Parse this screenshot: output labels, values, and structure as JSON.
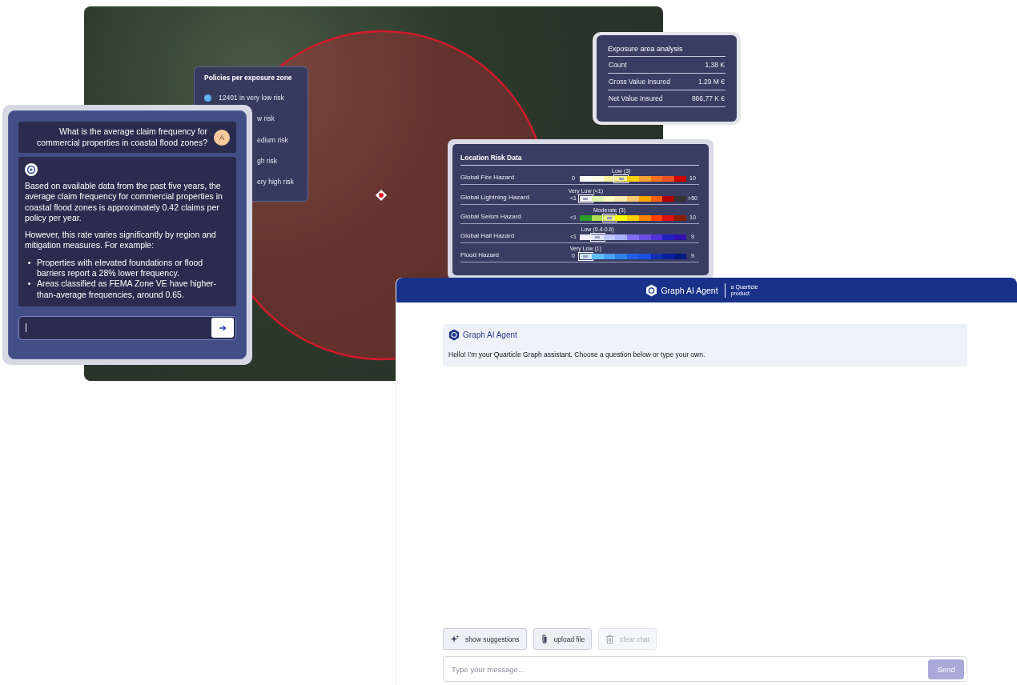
{
  "map": {
    "policies_panel": {
      "title": "Policies per exposure zone",
      "items": [
        {
          "label": "12401 in very low risk",
          "color": "#5fb4f5"
        },
        {
          "label": "w risk"
        },
        {
          "label": "edium risk"
        },
        {
          "label": "gh risk"
        },
        {
          "label": "ery high risk"
        }
      ]
    },
    "exposure_panel": {
      "title": "Exposure area analysis",
      "rows": [
        {
          "label": "Count",
          "value": "1,38 K"
        },
        {
          "label": "Gross Value Insured",
          "value": "1.29 M €"
        },
        {
          "label": "Net Value Insured",
          "value": "866,77 K €"
        }
      ]
    },
    "risk_panel": {
      "title": "Location Risk Data",
      "rows": [
        {
          "name": "Global Fire Hazard",
          "caption": "Low (3)",
          "min": "0",
          "max": "10",
          "segments": [
            {
              "color": "#ffffff",
              "selected": false
            },
            {
              "color": "#fffbe6",
              "selected": false
            },
            {
              "color": "#fff3a0",
              "selected": false
            },
            {
              "color": "#fff08a",
              "selected": true
            },
            {
              "color": "#ffd000",
              "selected": false
            },
            {
              "color": "#f5a030",
              "selected": false
            },
            {
              "color": "#f77020",
              "selected": false
            },
            {
              "color": "#ee5020",
              "selected": false
            },
            {
              "color": "#cc0000",
              "selected": false
            }
          ]
        },
        {
          "name": "Global Lightning Hazard",
          "caption": "Very Low (<1)",
          "min": "<1",
          "max": ">50",
          "segments": [
            {
              "color": "#ffffff",
              "selected": true
            },
            {
              "color": "#e0f5b0",
              "selected": false
            },
            {
              "color": "#ffffc0",
              "selected": false
            },
            {
              "color": "#ffe8b0",
              "selected": false
            },
            {
              "color": "#fdc870",
              "selected": false
            },
            {
              "color": "#ffa500",
              "selected": false
            },
            {
              "color": "#ff6010",
              "selected": false
            },
            {
              "color": "#b00000",
              "selected": false
            },
            {
              "color": "#333333",
              "selected": false
            }
          ]
        },
        {
          "name": "Global Seism Hazard",
          "caption": "Moderate (3)",
          "min": "<1",
          "max": "10",
          "segments": [
            {
              "color": "#2a9d2a",
              "selected": false
            },
            {
              "color": "#b0dd50",
              "selected": false
            },
            {
              "color": "#e8f080",
              "selected": true
            },
            {
              "color": "#ffff00",
              "selected": false
            },
            {
              "color": "#ffd000",
              "selected": false
            },
            {
              "color": "#ff8000",
              "selected": false
            },
            {
              "color": "#ff4000",
              "selected": false
            },
            {
              "color": "#dd1010",
              "selected": false
            },
            {
              "color": "#882000",
              "selected": false
            }
          ]
        },
        {
          "name": "Global Hail Hazard",
          "caption": "Low (0.4-0.6)",
          "min": "<1",
          "max": "9",
          "segments": [
            {
              "color": "#f0f0ff",
              "selected": false
            },
            {
              "color": "#dde4ff",
              "selected": true
            },
            {
              "color": "#c0c8ff",
              "selected": false
            },
            {
              "color": "#a8b0ff",
              "selected": false
            },
            {
              "color": "#8070f0",
              "selected": false
            },
            {
              "color": "#6a50e0",
              "selected": false
            },
            {
              "color": "#5030d8",
              "selected": false
            },
            {
              "color": "#2020c0",
              "selected": false
            },
            {
              "color": "#3010b0",
              "selected": false
            }
          ]
        },
        {
          "name": "Flood Hazard",
          "caption": "Very Low (1)",
          "min": "0",
          "max": "9",
          "segments": [
            {
              "color": "#d0e8ff",
              "selected": true
            },
            {
              "color": "#60c0f8",
              "selected": false
            },
            {
              "color": "#4aa0f0",
              "selected": false
            },
            {
              "color": "#3080e8",
              "selected": false
            },
            {
              "color": "#2060e0",
              "selected": false
            },
            {
              "color": "#1a50e0",
              "selected": false
            },
            {
              "color": "#1030b0",
              "selected": false
            },
            {
              "color": "#0820a0",
              "selected": false
            },
            {
              "color": "#051a80",
              "selected": false
            }
          ]
        }
      ]
    }
  },
  "assistant_chat": {
    "question": {
      "text": "What is the average claim frequency for commercial properties in coastal flood zones?",
      "avatar": "A"
    },
    "answer": {
      "paragraphs": [
        "Based on available data from the past five years, the average claim frequency for commercial properties in coastal flood zones is approximately 0.42 claims per policy per year.",
        "However, this rate varies significantly by region and mitigation measures. For example:"
      ],
      "bullets": [
        "Properties with elevated foundations or flood barriers report a 28% lower frequency.",
        "Areas classified as FEMA Zone VE have higher-than-average frequencies, around 0.65."
      ]
    }
  },
  "agent_window": {
    "header": {
      "title": "Graph AI Agent",
      "tagline": "a Quarticle product"
    },
    "messages": [
      {
        "sender": "Graph AI Agent",
        "text": "Hello! I’m your Quarticle Graph assistant. Choose a question below or type your own."
      }
    ],
    "actions": [
      {
        "label": "show suggestions",
        "kind": "sparkle",
        "disabled": false
      },
      {
        "label": "upload file",
        "kind": "paperclip",
        "disabled": false
      },
      {
        "label": "clear chat",
        "kind": "trash",
        "disabled": true
      }
    ],
    "message_input": {
      "placeholder": "Type your message..."
    },
    "send_button": {
      "label": "Send",
      "disabled": true
    }
  }
}
